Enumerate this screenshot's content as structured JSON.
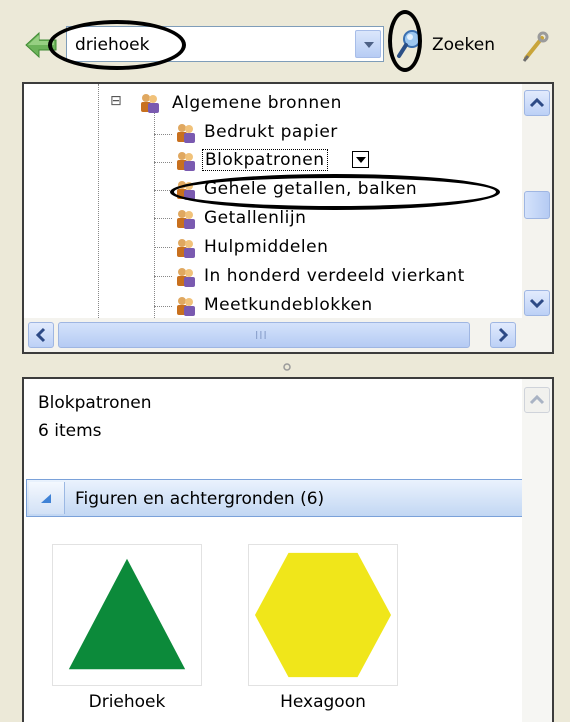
{
  "toolbar": {
    "search_value": "driehoek",
    "search_label": "Zoeken",
    "icons": [
      "green-back-arrow-icon",
      "dropdown-arrow-icon",
      "magnifier-icon",
      "tools-icon"
    ]
  },
  "tree": {
    "root": {
      "label": "Algemene bronnen",
      "expander": "⊟"
    },
    "items": [
      {
        "label": "Bedrukt papier"
      },
      {
        "label": "Blokpatronen",
        "selected": true
      },
      {
        "label": "Gehele getallen, balken"
      },
      {
        "label": "Getallenlijn"
      },
      {
        "label": "Hulpmiddelen"
      },
      {
        "label": "In honderd verdeeld vierkant"
      },
      {
        "label": "Meetkundeblokken"
      }
    ],
    "hscroll_grip": "III"
  },
  "content": {
    "title": "Blokpatronen",
    "count": "6 items",
    "group_label": "Figuren en achtergronden (6)",
    "tiles": [
      {
        "label": "Driehoek",
        "shape": "triangle",
        "color": "#0c8a3a"
      },
      {
        "label": "Hexagoon",
        "shape": "hexagon",
        "color": "#f0e61a"
      }
    ]
  },
  "colors": {
    "window_bg": "#ece9d8",
    "scroll_blue": "#bcd0f6",
    "group_bar": "#c2d7f3"
  }
}
